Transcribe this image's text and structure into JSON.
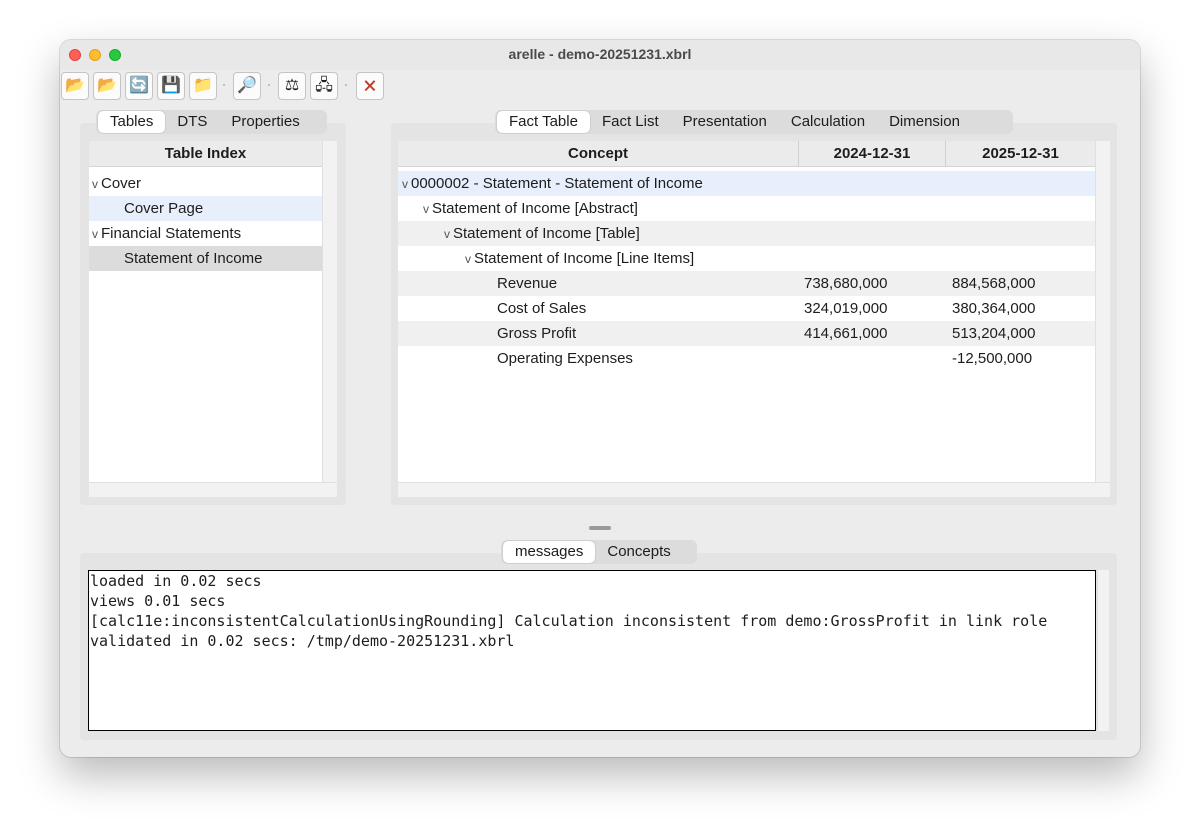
{
  "window": {
    "title": "arelle - demo-20251231.xbrl"
  },
  "toolbar": {
    "buttons": [
      {
        "name": "open-file-icon",
        "glyph": "📂"
      },
      {
        "name": "open-web-icon",
        "glyph": "📂"
      },
      {
        "name": "reload-icon",
        "glyph": "🔄"
      },
      {
        "name": "save-icon",
        "glyph": "💾"
      },
      {
        "name": "save-as-icon",
        "glyph": "📁"
      },
      {
        "name": "find-icon",
        "glyph": "🔎"
      },
      {
        "name": "validate-icon",
        "glyph": "⚖"
      },
      {
        "name": "compare-icon",
        "glyph": "🖧"
      },
      {
        "name": "close-file-icon",
        "glyph": "🗙"
      }
    ]
  },
  "left_tabs": [
    {
      "label": "Tables",
      "active": true
    },
    {
      "label": "DTS",
      "active": false
    },
    {
      "label": "Properties",
      "active": false
    }
  ],
  "table_index": {
    "header": "Table Index",
    "rows": [
      {
        "label": "Cover",
        "chevron": "v",
        "selected": false
      },
      {
        "label": "Cover Page",
        "chevron": "",
        "selected": true
      },
      {
        "label": "Financial Statements",
        "chevron": "v",
        "selected": false
      },
      {
        "label": "Statement of Income",
        "chevron": "",
        "selected": false,
        "highlight": true
      }
    ]
  },
  "right_tabs": [
    {
      "label": "Fact Table",
      "active": true
    },
    {
      "label": "Fact List",
      "active": false
    },
    {
      "label": "Presentation",
      "active": false
    },
    {
      "label": "Calculation",
      "active": false
    },
    {
      "label": "Dimension",
      "active": false
    }
  ],
  "fact_table": {
    "columns": [
      "Concept",
      "2024-12-31",
      "2025-12-31"
    ],
    "rows": [
      {
        "chevron": "v",
        "concept": "0000002 - Statement - Statement of Income",
        "v2024": "",
        "v2025": "",
        "selected": true
      },
      {
        "chevron": "v",
        "concept": "Statement of Income [Abstract]",
        "v2024": "",
        "v2025": ""
      },
      {
        "chevron": "v",
        "concept": "Statement of Income [Table]",
        "v2024": "",
        "v2025": ""
      },
      {
        "chevron": "v",
        "concept": "Statement of Income [Line Items]",
        "v2024": "",
        "v2025": ""
      },
      {
        "chevron": "",
        "concept": "Revenue",
        "v2024": "738,680,000",
        "v2025": "884,568,000"
      },
      {
        "chevron": "",
        "concept": "Cost of Sales",
        "v2024": "324,019,000",
        "v2025": "380,364,000"
      },
      {
        "chevron": "",
        "concept": "Gross Profit",
        "v2024": "414,661,000",
        "v2025": "513,204,000"
      },
      {
        "chevron": "",
        "concept": "Operating Expenses",
        "v2024": "",
        "v2025": "-12,500,000"
      }
    ]
  },
  "bottom_tabs": [
    {
      "label": "messages",
      "active": true
    },
    {
      "label": "Concepts",
      "active": false
    }
  ],
  "messages": [
    "loaded in 0.02 secs",
    "views 0.01 secs",
    "[calc11e:inconsistentCalculationUsingRounding] Calculation inconsistent from demo:GrossProfit in link role",
    "validated in 0.02 secs: /tmp/demo-20251231.xbrl"
  ]
}
